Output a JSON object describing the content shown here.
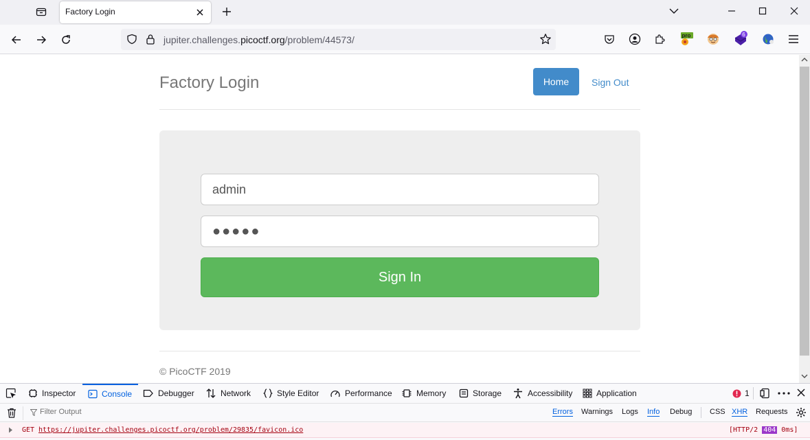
{
  "browser": {
    "tab_title": "Factory Login",
    "url_prefix": "jupiter.challenges.",
    "url_domain": "picoctf.org",
    "url_path": "/problem/44573/",
    "extension_badge_count": "6",
    "extension_label": "pro"
  },
  "page": {
    "brand": "Factory Login",
    "nav_home": "Home",
    "nav_signout": "Sign Out",
    "username_value": "admin",
    "password_value": "●●●●●",
    "signin_label": "Sign In",
    "footer": "© PicoCTF 2019"
  },
  "devtools": {
    "tabs": [
      "Inspector",
      "Console",
      "Debugger",
      "Network",
      "Style Editor",
      "Performance",
      "Memory",
      "Storage",
      "Accessibility",
      "Application"
    ],
    "active_tab": "Console",
    "error_count": "1",
    "filter_placeholder": "Filter Output",
    "levels": [
      "Errors",
      "Warnings",
      "Logs",
      "Info",
      "Debug"
    ],
    "types": [
      "CSS",
      "XHR",
      "Requests"
    ],
    "log": {
      "method": "GET",
      "url": "https://jupiter.challenges.picoctf.org/problem/29835/favicon.ico",
      "status_prefix": "[HTTP/2",
      "status_code": "404",
      "status_suffix": "0ms]"
    },
    "colors": {
      "accent": "#0060df",
      "error": "#a4000f",
      "status_badge": "#9b37c9"
    }
  },
  "colors": {
    "primary_btn": "#428bca",
    "success_btn": "#5cb85c",
    "jumbotron": "#eeeeee"
  }
}
